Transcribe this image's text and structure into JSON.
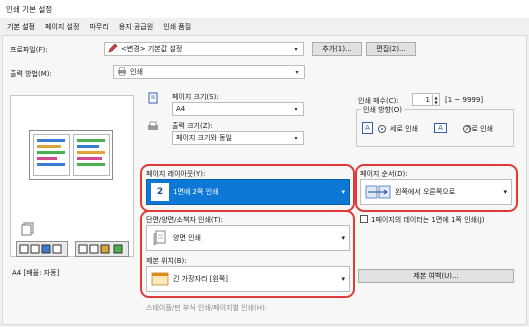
{
  "window": {
    "title": "인쇄 기본 설정"
  },
  "tabs": [
    "기본 설정",
    "페이지 설정",
    "마무리",
    "용지 공급원",
    "인쇄 품질"
  ],
  "profile": {
    "label": "프로파일(F):",
    "value": "<변경> 기본값 설정",
    "add_button": "추가(1)...",
    "edit_button": "편집(2)..."
  },
  "output_method": {
    "label": "출력 방법(M):",
    "value": "인쇄"
  },
  "page_size": {
    "label": "페이지 크기(S):",
    "value": "A4"
  },
  "output_size": {
    "label": "출력 크기(Z):",
    "value": "페이지 크기와 동일"
  },
  "copies": {
    "label": "인쇄 매수(C):",
    "value": "1",
    "range": "[1 ~ 9999]"
  },
  "orientation": {
    "label": "인쇄 방향(O)",
    "portrait": "세로 인쇄",
    "landscape": "가로 인쇄",
    "selected": "portrait"
  },
  "page_layout": {
    "label": "페이지 레이아웃(Y):",
    "value": "1면에 2쪽 인쇄",
    "icon_number": "2"
  },
  "page_order": {
    "label": "페이지 순서(D):",
    "value": "왼쪽에서 오른쪽으로"
  },
  "duplex": {
    "label": "단면/양면/소책자 인쇄(T):",
    "value": "양면 인쇄"
  },
  "binding": {
    "label": "제본 위치(B):",
    "value": "긴 가장자리 [왼쪽]"
  },
  "one_page_option": {
    "label": "1페이지의 데이터는 1면에 1쪽 인쇄(J)",
    "checked": false
  },
  "binding_margin_button": "제본 여백(U)...",
  "staple_label": "스테이플/펀 부식 인쇄/페이지별 인쇄(H):",
  "preview": {
    "caption": "A4 [배율: 자동]"
  },
  "colors": {
    "accent": "#1a6fd1",
    "highlight": "#e03a3a",
    "selection": "#0d78d6"
  }
}
